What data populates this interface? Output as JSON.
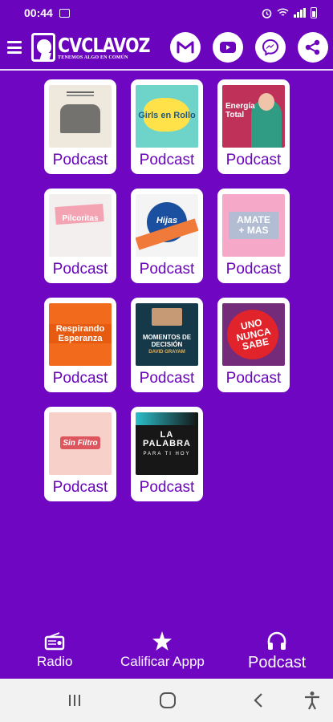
{
  "status_bar": {
    "time": "00:44"
  },
  "header": {
    "brand": "CVCLAVOZ",
    "tagline": "TENEMOS ALGO EN COMÚN"
  },
  "actions": [
    "gmail-icon",
    "youtube-icon",
    "messenger-icon",
    "share-icon"
  ],
  "podcasts": [
    {
      "label": "Podcast",
      "art": ""
    },
    {
      "label": "Podcast",
      "art": "Girls en Rollo"
    },
    {
      "label": "Podcast",
      "art": "Energía Total"
    },
    {
      "label": "Podcast",
      "art": "Pilcoritas"
    },
    {
      "label": "Podcast",
      "art": "Hijas"
    },
    {
      "label": "Podcast",
      "art": "AMATE + MAS"
    },
    {
      "label": "Podcast",
      "art": "Respirando Esperanza"
    },
    {
      "label": "Podcast",
      "art": "MOMENTOS DE DECISIÓN"
    },
    {
      "label": "Podcast",
      "art": "UNO NUNCA SABE"
    },
    {
      "label": "Podcast",
      "art": "Sin Filtro"
    },
    {
      "label": "Podcast",
      "art": "LA PALABRA"
    }
  ],
  "podcast_sub": {
    "art_8": "DAVID GRAYAM",
    "art_11": "PARA TI HOY"
  },
  "bottom_nav": {
    "radio": "Radio",
    "rate": "Calificar Appp",
    "podcast": "Podcast"
  },
  "colors": {
    "brand_purple": "#6e06c2",
    "card_label": "#6a04bd"
  }
}
